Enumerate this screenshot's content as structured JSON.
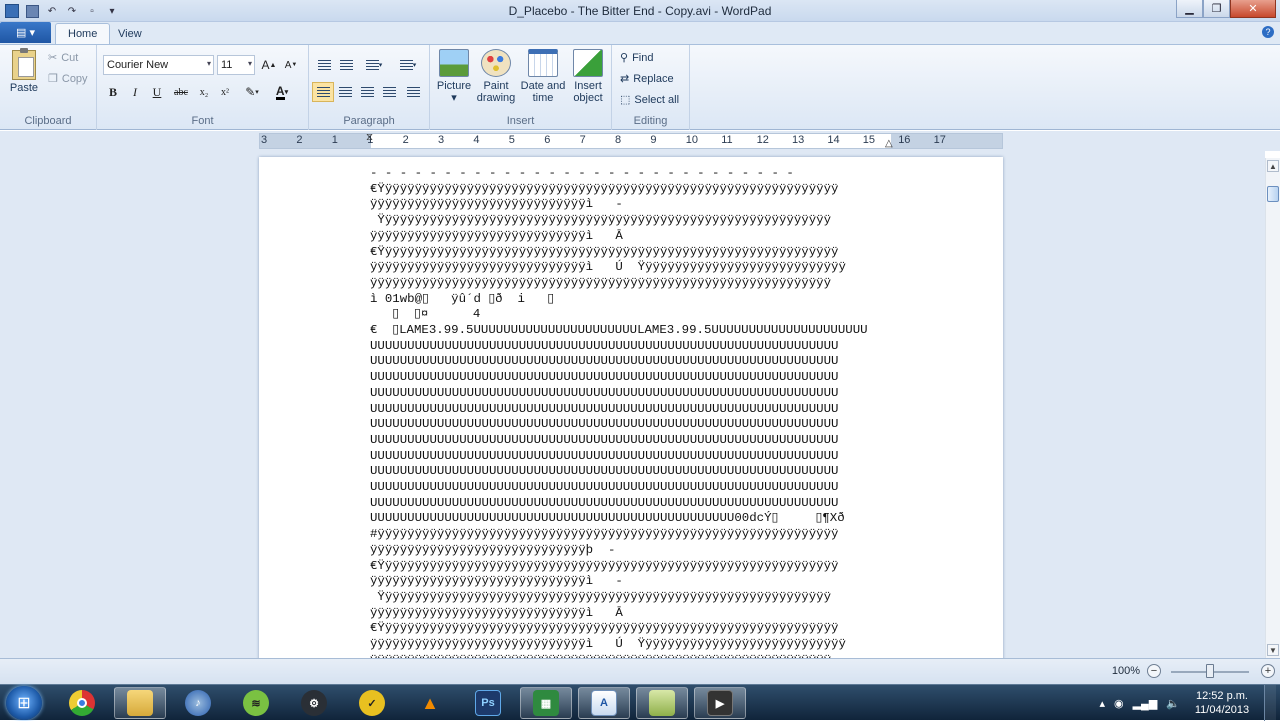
{
  "window": {
    "title": "D_Placebo - The Bitter End - Copy.avi - WordPad"
  },
  "tabs": [
    {
      "label": "Home"
    },
    {
      "label": "View"
    }
  ],
  "ribbon": {
    "clipboard": {
      "label": "Clipboard",
      "paste": "Paste",
      "cut": "Cut",
      "copy": "Copy"
    },
    "font": {
      "label": "Font",
      "family": "Courier New",
      "size": "11",
      "grow": "A",
      "shrink": "A",
      "bold": "B",
      "italic": "I",
      "underline": "U",
      "strike": "abc",
      "sub": "x₂",
      "sup": "x²"
    },
    "paragraph": {
      "label": "Paragraph"
    },
    "insert": {
      "label": "Insert",
      "picture": [
        "Picture",
        "▾"
      ],
      "paint": [
        "Paint",
        "drawing"
      ],
      "datetime": [
        "Date and",
        "time"
      ],
      "object": [
        "Insert",
        "object"
      ]
    },
    "editing": {
      "label": "Editing",
      "find": "Find",
      "replace": "Replace",
      "select_all": "Select all"
    }
  },
  "ruler": [
    "3",
    "2",
    "1",
    "1",
    "2",
    "3",
    "4",
    "5",
    "6",
    "7",
    "8",
    "9",
    "10",
    "11",
    "12",
    "13",
    "14",
    "15",
    "16",
    "17"
  ],
  "document": {
    "lines": [
      "- - - - - - - - - - - - - - - - - - - - - - - - - - - - -",
      "€Ÿÿÿÿÿÿÿÿÿÿÿÿÿÿÿÿÿÿÿÿÿÿÿÿÿÿÿÿÿÿÿÿÿÿÿÿÿÿÿÿÿÿÿÿÿÿÿÿÿÿÿÿÿÿÿÿÿÿÿÿÿÿ",
      "ÿÿÿÿÿÿÿÿÿÿÿÿÿÿÿÿÿÿÿÿÿÿÿÿÿÿÿÿÿì   -",
      " Ÿÿÿÿÿÿÿÿÿÿÿÿÿÿÿÿÿÿÿÿÿÿÿÿÿÿÿÿÿÿÿÿÿÿÿÿÿÿÿÿÿÿÿÿÿÿÿÿÿÿÿÿÿÿÿÿÿÿÿÿÿ",
      "ÿÿÿÿÿÿÿÿÿÿÿÿÿÿÿÿÿÿÿÿÿÿÿÿÿÿÿÿÿì   Ā",
      "€Ÿÿÿÿÿÿÿÿÿÿÿÿÿÿÿÿÿÿÿÿÿÿÿÿÿÿÿÿÿÿÿÿÿÿÿÿÿÿÿÿÿÿÿÿÿÿÿÿÿÿÿÿÿÿÿÿÿÿÿÿÿÿ",
      "ÿÿÿÿÿÿÿÿÿÿÿÿÿÿÿÿÿÿÿÿÿÿÿÿÿÿÿÿÿì   Ú  Ÿÿÿÿÿÿÿÿÿÿÿÿÿÿÿÿÿÿÿÿÿÿÿÿÿÿÿÿ",
      "ÿÿÿÿÿÿÿÿÿÿÿÿÿÿÿÿÿÿÿÿÿÿÿÿÿÿÿÿÿÿÿÿÿÿÿÿÿÿÿÿÿÿÿÿÿÿÿÿÿÿÿÿÿÿÿÿÿÿÿÿÿÿ",
      "ì 01wb@▯   ÿû´d ▯ð  i   ▯",
      "   ▯  ▯¤      4",
      "€  ▯LAME3.99.5UUUUUUUUUUUUUUUUUUUUUULAME3.99.5UUUUUUUUUUUUUUUUUUUUU",
      "UUUUUUUUUUUUUUUUUUUUUUUUUUUUUUUUUUUUUUUUUUUUUUUUUUUUUUUUUUUUUUU",
      "UUUUUUUUUUUUUUUUUUUUUUUUUUUUUUUUUUUUUUUUUUUUUUUUUUUUUUUUUUUUUUU",
      "UUUUUUUUUUUUUUUUUUUUUUUUUUUUUUUUUUUUUUUUUUUUUUUUUUUUUUUUUUUUUUU",
      "UUUUUUUUUUUUUUUUUUUUUUUUUUUUUUUUUUUUUUUUUUUUUUUUUUUUUUUUUUUUUUU",
      "UUUUUUUUUUUUUUUUUUUUUUUUUUUUUUUUUUUUUUUUUUUUUUUUUUUUUUUUUUUUUUU",
      "UUUUUUUUUUUUUUUUUUUUUUUUUUUUUUUUUUUUUUUUUUUUUUUUUUUUUUUUUUUUUUU",
      "UUUUUUUUUUUUUUUUUUUUUUUUUUUUUUUUUUUUUUUUUUUUUUUUUUUUUUUUUUUUUUU",
      "UUUUUUUUUUUUUUUUUUUUUUUUUUUUUUUUUUUUUUUUUUUUUUUUUUUUUUUUUUUUUUU",
      "UUUUUUUUUUUUUUUUUUUUUUUUUUUUUUUUUUUUUUUUUUUUUUUUUUUUUUUUUUUUUUU",
      "UUUUUUUUUUUUUUUUUUUUUUUUUUUUUUUUUUUUUUUUUUUUUUUUUUUUUUUUUUUUUUU",
      "UUUUUUUUUUUUUUUUUUUUUUUUUUUUUUUUUUUUUUUUUUUUUUUUUUUUUUUUUUUUUUU",
      "UUUUUUUUUUUUUUUUUUUUUUUUUUUUUUUUUUUUUUUUUUUUUUUUU00dcÝ▯     ▯¶Xð",
      "#ÿÿÿÿÿÿÿÿÿÿÿÿÿÿÿÿÿÿÿÿÿÿÿÿÿÿÿÿÿÿÿÿÿÿÿÿÿÿÿÿÿÿÿÿÿÿÿÿÿÿÿÿÿÿÿÿÿÿÿÿÿÿ",
      "ÿÿÿÿÿÿÿÿÿÿÿÿÿÿÿÿÿÿÿÿÿÿÿÿÿÿÿÿÿþ  -",
      "€Ÿÿÿÿÿÿÿÿÿÿÿÿÿÿÿÿÿÿÿÿÿÿÿÿÿÿÿÿÿÿÿÿÿÿÿÿÿÿÿÿÿÿÿÿÿÿÿÿÿÿÿÿÿÿÿÿÿÿÿÿÿÿ",
      "ÿÿÿÿÿÿÿÿÿÿÿÿÿÿÿÿÿÿÿÿÿÿÿÿÿÿÿÿÿì   -",
      " Ÿÿÿÿÿÿÿÿÿÿÿÿÿÿÿÿÿÿÿÿÿÿÿÿÿÿÿÿÿÿÿÿÿÿÿÿÿÿÿÿÿÿÿÿÿÿÿÿÿÿÿÿÿÿÿÿÿÿÿÿÿ",
      "ÿÿÿÿÿÿÿÿÿÿÿÿÿÿÿÿÿÿÿÿÿÿÿÿÿÿÿÿÿì   Ā",
      "€Ÿÿÿÿÿÿÿÿÿÿÿÿÿÿÿÿÿÿÿÿÿÿÿÿÿÿÿÿÿÿÿÿÿÿÿÿÿÿÿÿÿÿÿÿÿÿÿÿÿÿÿÿÿÿÿÿÿÿÿÿÿÿ",
      "ÿÿÿÿÿÿÿÿÿÿÿÿÿÿÿÿÿÿÿÿÿÿÿÿÿÿÿÿÿì   Ú  Ÿÿÿÿÿÿÿÿÿÿÿÿÿÿÿÿÿÿÿÿÿÿÿÿÿÿÿÿ",
      "ÿÿÿÿÿÿÿÿÿÿÿÿÿÿÿÿÿÿÿÿÿÿÿÿÿÿÿÿÿÿÿÿÿÿÿÿÿÿÿÿÿÿÿÿÿÿÿÿÿÿÿÿÿÿÿÿÿÿÿÿÿÿ"
    ]
  },
  "status": {
    "zoom": "100%",
    "zoom_out": "−",
    "zoom_in": "+",
    "zoom_level": 0.5
  },
  "taskbar": {
    "apps": [
      "chrome-icon",
      "explorer-icon",
      "itunes-icon",
      "spotify-icon",
      "steam-icon",
      "norton-icon",
      "vlc-icon",
      "photoshop-icon",
      "excel-icon",
      "wordpad-icon",
      "wallet-icon",
      "media-icon"
    ],
    "ps_label": "Ps",
    "clock_time": "12:52 p.m.",
    "clock_date": "11/04/2013"
  },
  "colors": {
    "accent": "#1f56a4",
    "ribbon": "#dce7f5",
    "taskbar": "#10243a"
  }
}
